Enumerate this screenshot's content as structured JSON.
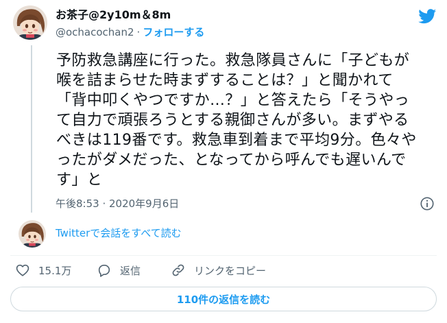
{
  "user": {
    "display_name": "お茶子@2y10m＆8m",
    "handle": "@ochacochan2",
    "separator": "·",
    "follow_label": "フォローする"
  },
  "tweet": {
    "lines": [
      "予防救急講座に行った。救急隊員さんに「子どもが",
      "喉を詰まらせた時まずすることは？」と聞かれて",
      "「背中叩くやつですか…？」と答えたら「そうやっ",
      "て自力で頑張ろうとする親御さんが多い。まずやる",
      "べきは119番です。救急車到着まで平均9分。色々や",
      "ったがダメだった、となってから呼んでも遅いんで",
      "す」と"
    ],
    "timestamp": "午後8:53 · 2020年9月6日"
  },
  "conversation": {
    "read_label": "Twitterで会話をすべて読む"
  },
  "actions": {
    "like_count": "15.1万",
    "reply_label": "返信",
    "copy_link_label": "リンクをコピー"
  },
  "replies_button": {
    "label": "110件の返信を読む"
  },
  "colors": {
    "accent": "#1d9bf0",
    "text": "#0f1419",
    "muted": "#536471",
    "border": "#cfd9de"
  },
  "icons": {
    "brand": "twitter-bird-icon",
    "info": "info-icon",
    "like": "heart-icon",
    "reply": "speech-bubble-icon",
    "copy": "link-icon"
  }
}
